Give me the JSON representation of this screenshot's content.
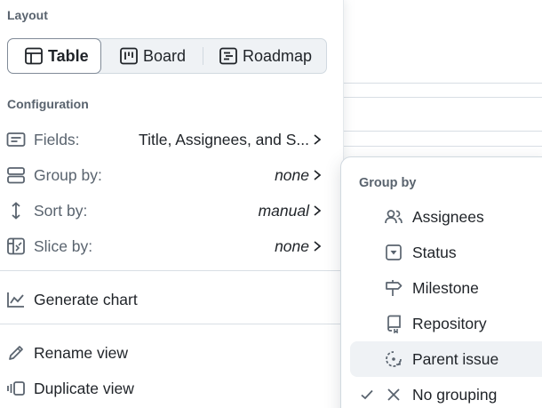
{
  "layout": {
    "title": "Layout",
    "tabs": [
      {
        "label": "Table",
        "icon": "table-icon",
        "active": true
      },
      {
        "label": "Board",
        "icon": "board-icon",
        "active": false
      },
      {
        "label": "Roadmap",
        "icon": "roadmap-icon",
        "active": false
      }
    ]
  },
  "configuration": {
    "title": "Configuration",
    "fields": {
      "label": "Fields:",
      "value": "Title, Assignees, and S..."
    },
    "group_by": {
      "label": "Group by:",
      "value": "none"
    },
    "sort_by": {
      "label": "Sort by:",
      "value": "manual"
    },
    "slice_by": {
      "label": "Slice by:",
      "value": "none"
    }
  },
  "actions": {
    "generate_chart": "Generate chart",
    "rename_view": "Rename view",
    "duplicate_view": "Duplicate view"
  },
  "group_by_menu": {
    "title": "Group by",
    "items": [
      {
        "label": "Assignees",
        "icon": "people-icon"
      },
      {
        "label": "Status",
        "icon": "single-select-icon"
      },
      {
        "label": "Milestone",
        "icon": "milestone-icon"
      },
      {
        "label": "Repository",
        "icon": "repo-icon"
      },
      {
        "label": "Parent issue",
        "icon": "issue-tracked-by-icon",
        "hovered": true
      },
      {
        "label": "No grouping",
        "icon": "x-icon",
        "selected": true
      }
    ]
  },
  "colors": {
    "muted_text": "#59636e",
    "text": "#1f2328",
    "border": "#d1d9e0",
    "hover_bg": "#eff2f5"
  }
}
